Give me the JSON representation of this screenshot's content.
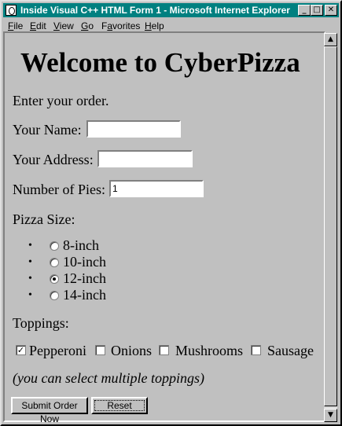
{
  "window": {
    "title": "Inside Visual C++ HTML Form 1 - Microsoft Internet Explorer",
    "controls": {
      "minimize": "_",
      "maximize": "□",
      "close": "✕"
    }
  },
  "menu": [
    "File",
    "Edit",
    "View",
    "Go",
    "Favorites",
    "Help"
  ],
  "menu_accel": [
    "F",
    "E",
    "V",
    "G",
    "a",
    "H"
  ],
  "page": {
    "heading": "Welcome to CyberPizza",
    "intro": "Enter your order.",
    "name_label": "Your Name:",
    "name_value": "",
    "address_label": "Your Address:",
    "address_value": "",
    "pies_label": "Number of Pies:",
    "pies_value": "1",
    "size_label": "Pizza Size:",
    "sizes": [
      "8-inch",
      "10-inch",
      "12-inch",
      "14-inch"
    ],
    "selected_size": "12-inch",
    "toppings_label": "Toppings:",
    "toppings": [
      "Pepperoni",
      "Onions",
      "Mushrooms",
      "Sausage"
    ],
    "toppings_checked": [
      "Pepperoni"
    ],
    "note": "(you can select multiple toppings)",
    "submit_label": "Submit Order Now",
    "reset_label": "Reset"
  }
}
